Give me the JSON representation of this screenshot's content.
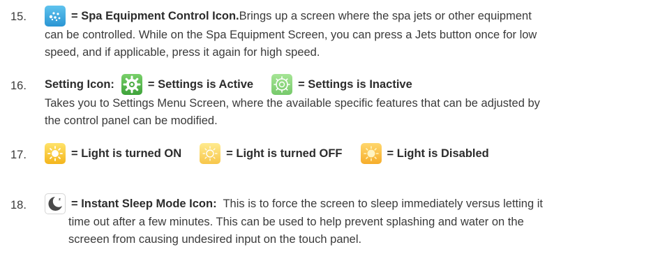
{
  "items": [
    {
      "number": "15.",
      "icon": "spa-jets-icon",
      "heading": "= Spa Equipment Control Icon.",
      "line1_rest": " Brings up a screen where the spa jets or other equipment",
      "line2": "can be controlled. While on the Spa Equipment Screen, you can press a Jets button once for low",
      "line3": "speed, and if applicable, press it again for high speed."
    },
    {
      "number": "16.",
      "label": "Setting Icon:",
      "active_label": "= Settings is Active",
      "inactive_label": "= Settings is Inactive",
      "icons": [
        "gear-active-icon",
        "gear-inactive-icon"
      ],
      "line2": "Takes you to Settings Menu Screen, where the available specific features that can be adjusted by",
      "line3": "the control panel can be modified."
    },
    {
      "number": "17.",
      "icons": [
        "light-on-icon",
        "light-off-icon",
        "light-disabled-icon"
      ],
      "on_label": "= Light is turned ON",
      "off_label": "= Light is turned OFF",
      "disabled_label": "= Light is Disabled"
    },
    {
      "number": "18.",
      "icon": "sleep-mode-icon",
      "heading": "= Instant Sleep Mode Icon:",
      "line1_rest": "  This is to force the screen to sleep immediately versus letting it",
      "line2": "time out after a few minutes. This can be used to help prevent splashing and water on the",
      "line3": "screeen from causing undesired input on the touch panel."
    }
  ],
  "colors": {
    "text": "#3a3a3a",
    "spa_blue": "#2a95d3",
    "gear_green": "#3ea33a",
    "light_yellow": "#f4b51c"
  }
}
